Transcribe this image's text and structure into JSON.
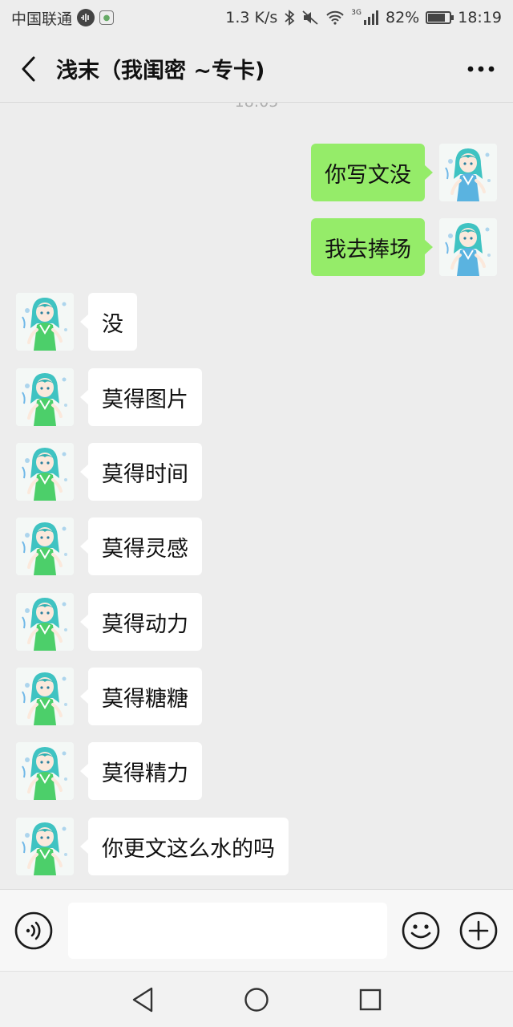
{
  "status_bar": {
    "carrier": "中国联通",
    "speed": "1.3 K/s",
    "network_type": "3G",
    "battery_percent": "82%",
    "battery_level": 0.82,
    "time": "18:19"
  },
  "header": {
    "title": "浅末（我闺密 ~专卡)"
  },
  "chat": {
    "timestamp": "18:05",
    "messages": [
      {
        "direction": "out",
        "text": "你写文没"
      },
      {
        "direction": "out",
        "text": "我去捧场"
      },
      {
        "direction": "in",
        "text": "没"
      },
      {
        "direction": "in",
        "text": "莫得图片"
      },
      {
        "direction": "in",
        "text": "莫得时间"
      },
      {
        "direction": "in",
        "text": "莫得灵感"
      },
      {
        "direction": "in",
        "text": "莫得动力"
      },
      {
        "direction": "in",
        "text": "莫得糖糖"
      },
      {
        "direction": "in",
        "text": "莫得精力"
      },
      {
        "direction": "in",
        "text": "你更文这么水的吗"
      }
    ]
  },
  "colors": {
    "background": "#ededed",
    "outgoing_bubble": "#95ec69",
    "incoming_bubble": "#ffffff"
  },
  "input_bar": {
    "placeholder": ""
  },
  "icons": {
    "back": "back-arrow-icon",
    "more": "more-dots-icon",
    "voice": "voice-icon",
    "emoji": "emoji-icon",
    "plus": "plus-icon",
    "nav_back": "nav-back-icon",
    "nav_home": "nav-home-icon",
    "nav_recent": "nav-recent-icon"
  }
}
